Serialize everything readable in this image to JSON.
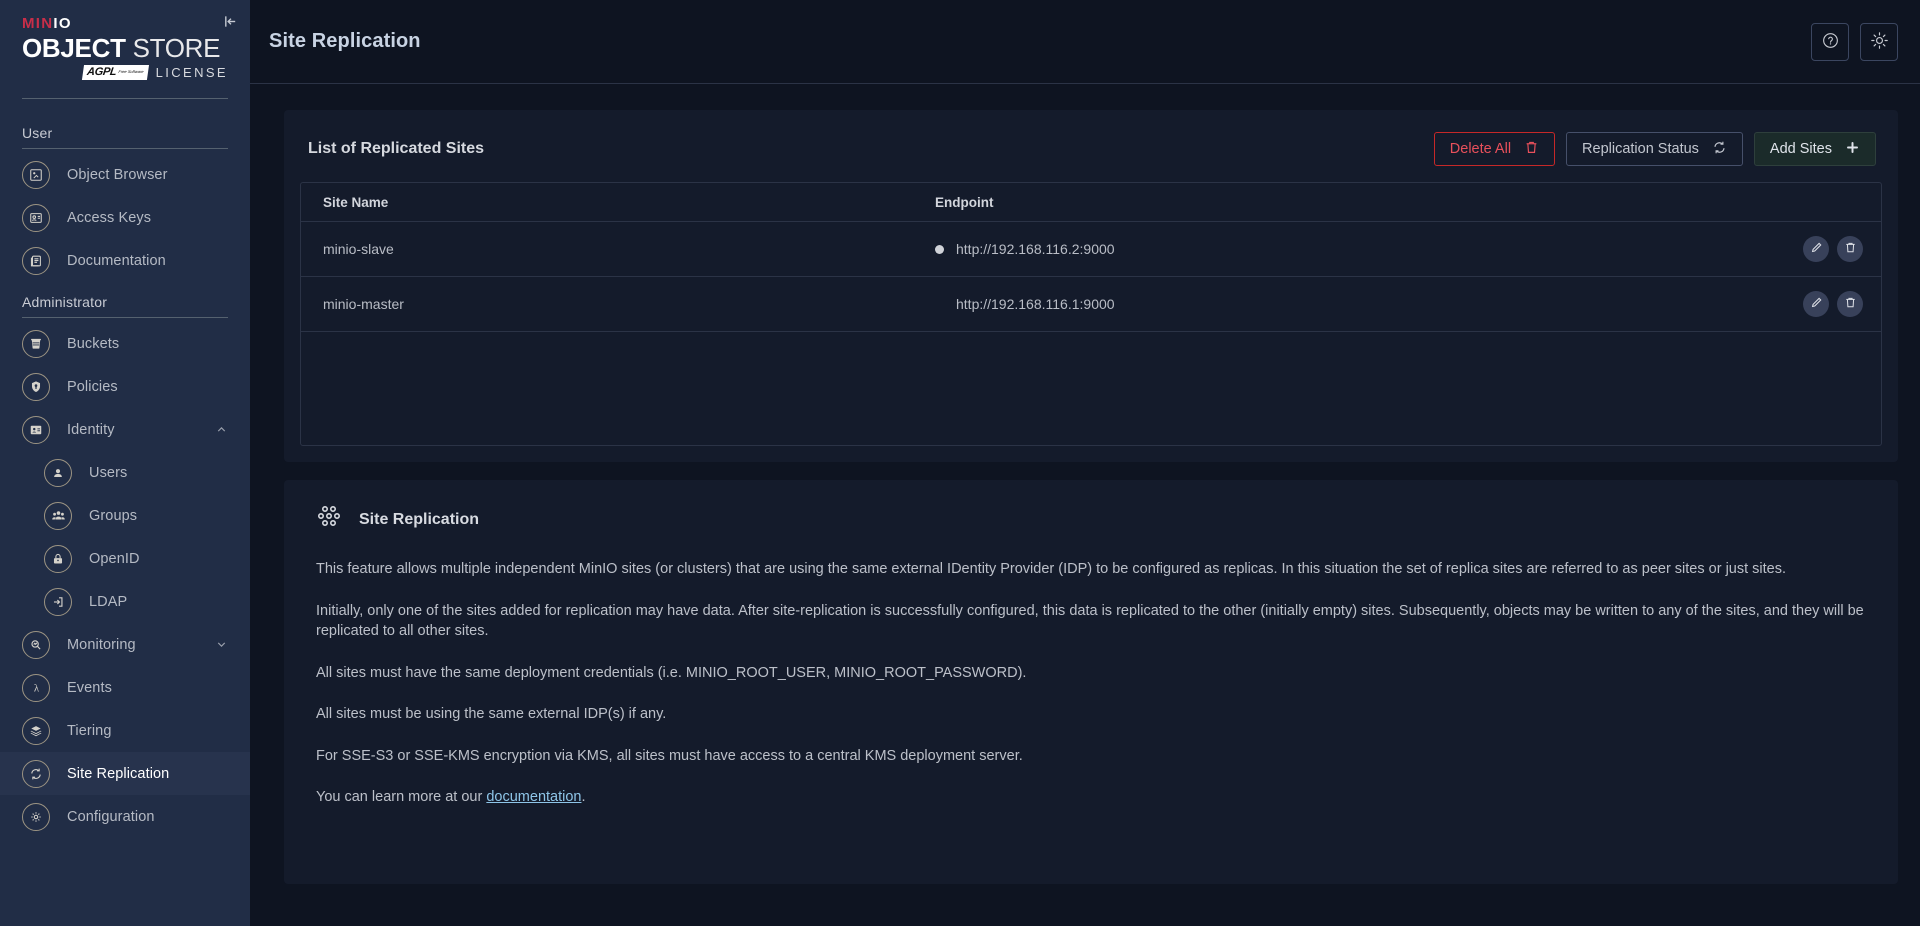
{
  "brand": {
    "minio_min": "MIN",
    "minio_io": "IO",
    "object": "OBJECT",
    "store": "STORE",
    "agpl_main": "AGPL",
    "agpl_sub": "Free Software",
    "license": "LICENSE"
  },
  "sidebar": {
    "sections": [
      {
        "label": "User",
        "items": [
          {
            "label": "Object Browser",
            "icon": "object-browser-icon",
            "active": false,
            "sub": false
          },
          {
            "label": "Access Keys",
            "icon": "access-keys-icon",
            "active": false,
            "sub": false
          },
          {
            "label": "Documentation",
            "icon": "documentation-icon",
            "active": false,
            "sub": false
          }
        ]
      },
      {
        "label": "Administrator",
        "items": [
          {
            "label": "Buckets",
            "icon": "buckets-icon",
            "active": false,
            "sub": false
          },
          {
            "label": "Policies",
            "icon": "policies-icon",
            "active": false,
            "sub": false
          },
          {
            "label": "Identity",
            "icon": "identity-icon",
            "active": false,
            "sub": false,
            "chevron": "up"
          },
          {
            "label": "Users",
            "icon": "users-icon",
            "active": false,
            "sub": true
          },
          {
            "label": "Groups",
            "icon": "groups-icon",
            "active": false,
            "sub": true
          },
          {
            "label": "OpenID",
            "icon": "openid-icon",
            "active": false,
            "sub": true
          },
          {
            "label": "LDAP",
            "icon": "ldap-icon",
            "active": false,
            "sub": true
          },
          {
            "label": "Monitoring",
            "icon": "monitoring-icon",
            "active": false,
            "sub": false,
            "chevron": "down"
          },
          {
            "label": "Events",
            "icon": "events-icon",
            "active": false,
            "sub": false
          },
          {
            "label": "Tiering",
            "icon": "tiering-icon",
            "active": false,
            "sub": false
          },
          {
            "label": "Site Replication",
            "icon": "site-replication-icon",
            "active": true,
            "sub": false
          },
          {
            "label": "Configuration",
            "icon": "configuration-icon",
            "active": false,
            "sub": false
          }
        ]
      }
    ]
  },
  "topbar": {
    "title": "Site Replication",
    "help_icon": "help-circle-icon",
    "theme_icon": "sun-icon"
  },
  "list_panel": {
    "title": "List of Replicated Sites",
    "buttons": {
      "delete_all": "Delete All",
      "replication_status": "Replication Status",
      "add_sites": "Add Sites"
    },
    "columns": [
      "Site Name",
      "Endpoint"
    ],
    "rows": [
      {
        "name": "minio-slave",
        "endpoint": "http://192.168.116.2:9000",
        "has_status_dot": true
      },
      {
        "name": "minio-master",
        "endpoint": "http://192.168.116.1:9000",
        "has_status_dot": false
      }
    ],
    "row_actions": {
      "edit": "edit-pencil-icon",
      "delete": "trash-icon"
    }
  },
  "info_panel": {
    "title": "Site Replication",
    "paragraphs": [
      "This feature allows multiple independent MinIO sites (or clusters) that are using the same external IDentity Provider (IDP) to be configured as replicas. In this situation the set of replica sites are referred to as peer sites or just sites.",
      "Initially, only one of the sites added for replication may have data. After site-replication is successfully configured, this data is replicated to the other (initially empty) sites. Subsequently, objects may be written to any of the sites, and they will be replicated to all other sites.",
      "All sites must have the same deployment credentials (i.e. MINIO_ROOT_USER, MINIO_ROOT_PASSWORD).",
      "All sites must be using the same external IDP(s) if any.",
      "For SSE-S3 or SSE-KMS encryption via KMS, all sites must have access to a central KMS deployment server."
    ],
    "learn_more_prefix": "You can learn more at our ",
    "learn_more_link": "documentation",
    "learn_more_suffix": "."
  },
  "colors": {
    "sidebar_bg": "#212d46",
    "main_bg": "#0e1421",
    "card_bg": "#141b2b",
    "accent_red": "#c72e49",
    "delete_red": "#e8505b",
    "link_blue": "#8ec5e8",
    "add_green_bg": "#1b2b2a"
  }
}
